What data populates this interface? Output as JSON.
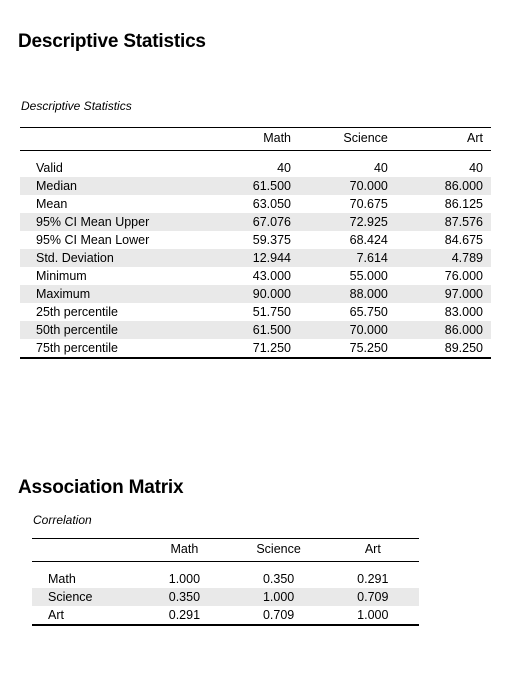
{
  "descriptive": {
    "heading": "Descriptive Statistics",
    "caption": "Descriptive Statistics",
    "columns": [
      "",
      "Math",
      "Science",
      "Art"
    ],
    "rows": [
      {
        "label": "Valid",
        "values": [
          "40",
          "40",
          "40"
        ]
      },
      {
        "label": "Median",
        "values": [
          "61.500",
          "70.000",
          "86.000"
        ]
      },
      {
        "label": "Mean",
        "values": [
          "63.050",
          "70.675",
          "86.125"
        ]
      },
      {
        "label": "95% CI Mean Upper",
        "values": [
          "67.076",
          "72.925",
          "87.576"
        ]
      },
      {
        "label": "95% CI Mean Lower",
        "values": [
          "59.375",
          "68.424",
          "84.675"
        ]
      },
      {
        "label": "Std. Deviation",
        "values": [
          "12.944",
          "7.614",
          "4.789"
        ]
      },
      {
        "label": "Minimum",
        "values": [
          "43.000",
          "55.000",
          "76.000"
        ]
      },
      {
        "label": "Maximum",
        "values": [
          "90.000",
          "88.000",
          "97.000"
        ]
      },
      {
        "label": "25th percentile",
        "values": [
          "51.750",
          "65.750",
          "83.000"
        ]
      },
      {
        "label": "50th percentile",
        "values": [
          "61.500",
          "70.000",
          "86.000"
        ]
      },
      {
        "label": "75th percentile",
        "values": [
          "71.250",
          "75.250",
          "89.250"
        ]
      }
    ]
  },
  "association": {
    "heading": "Association Matrix",
    "caption": "Correlation",
    "columns": [
      "",
      "Math",
      "Science",
      "Art"
    ],
    "rows": [
      {
        "label": "Math",
        "values": [
          "1.000",
          "0.350",
          "0.291"
        ]
      },
      {
        "label": "Science",
        "values": [
          "0.350",
          "1.000",
          "0.709"
        ]
      },
      {
        "label": "Art",
        "values": [
          "0.291",
          "0.709",
          "1.000"
        ]
      }
    ]
  },
  "style": {
    "stripe_color": "#e9e9e9",
    "rule_color": "#000000",
    "text_color": "#000000",
    "background": "#ffffff"
  }
}
